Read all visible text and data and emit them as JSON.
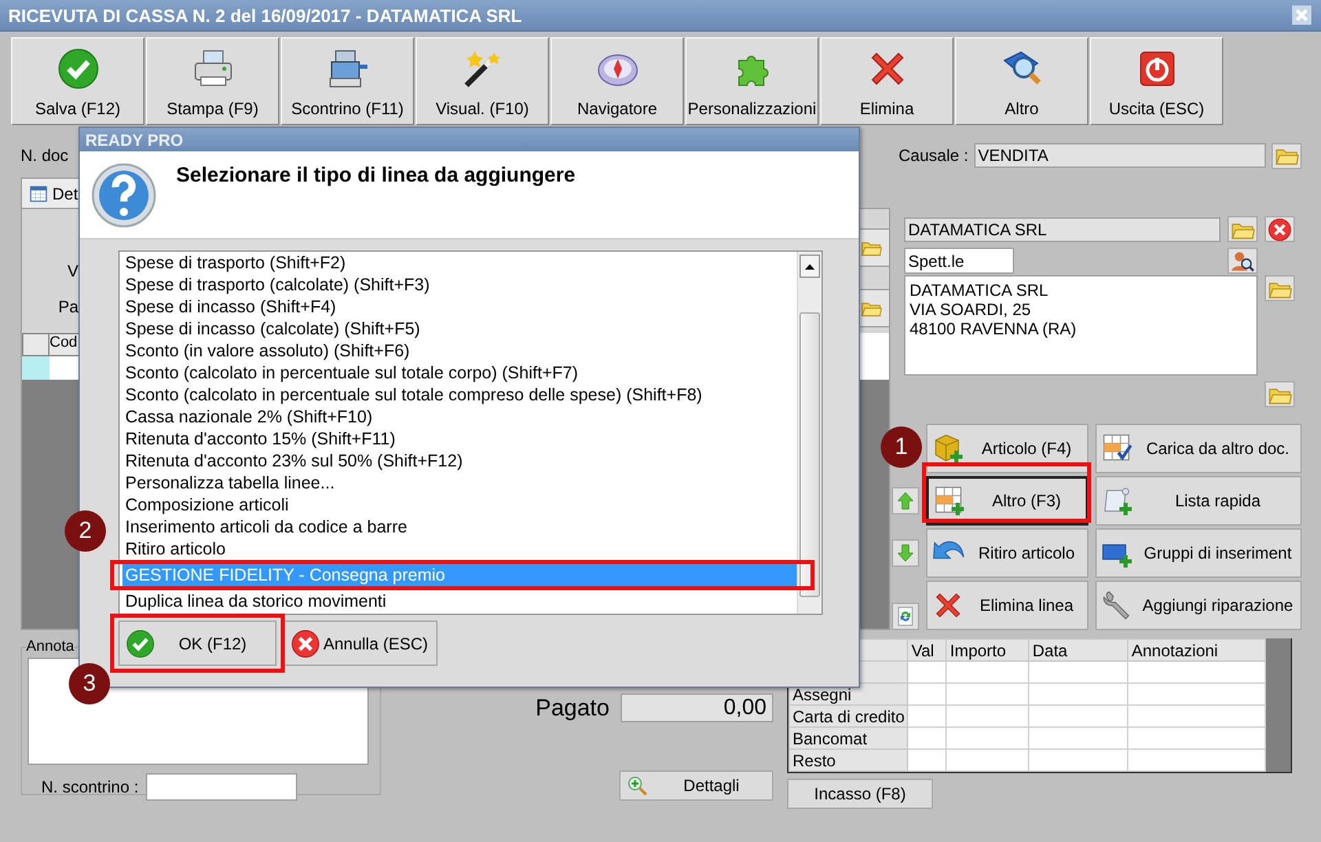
{
  "window": {
    "title": "RICEVUTA DI CASSA N. 2 del 16/09/2017 - DATAMATICA SRL"
  },
  "toolbar": [
    "Salva (F12)",
    "Stampa (F9)",
    "Scontrino (F11)",
    "Visual. (F10)",
    "Navigatore",
    "Personalizzazioni",
    "Elimina",
    "Altro",
    "Uscita (ESC)"
  ],
  "document": {
    "number_label": "N. doc",
    "causale_label": "Causale :",
    "causale": "VENDITA",
    "tab": "Det",
    "labels": [
      "V",
      "Pa"
    ],
    "grid_column": "Cod"
  },
  "customer": {
    "name": "DATAMATICA SRL",
    "salutation": "Spett.le",
    "address": [
      "DATAMATICA SRL",
      "VIA SOARDI, 25",
      "48100 RAVENNA (RA)"
    ]
  },
  "line_buttons": [
    {
      "label": "Articolo (F4)",
      "focused": false
    },
    {
      "label": "Carica da altro doc.",
      "focused": false
    },
    {
      "label": "Altro (F3)",
      "focused": true
    },
    {
      "label": "Lista rapida",
      "focused": false
    },
    {
      "label": "Ritiro articolo",
      "focused": false
    },
    {
      "label": "Gruppi di inseriment",
      "focused": false
    },
    {
      "label": "Elimina linea",
      "focused": false
    },
    {
      "label": "Aggiungi riparazione",
      "focused": false
    }
  ],
  "notes": {
    "label": "Annota",
    "receipt_label": "N. scontrino :"
  },
  "totals": {
    "paid_label": "Pagato",
    "paid": "0,00",
    "details_button": "Dettagli"
  },
  "payments": {
    "columns": [
      "Val",
      "Importo",
      "Data",
      "Annotazioni"
    ],
    "rows": [
      "Assegni",
      "Carta di credito",
      "Bancomat",
      "Resto"
    ],
    "button": "Incasso (F8)"
  },
  "dialog": {
    "title": "READY PRO",
    "heading": "Selezionare il tipo di linea da aggiungere",
    "items": [
      {
        "label": "Spese di trasporto (Shift+F2)",
        "selected": false
      },
      {
        "label": "Spese di trasporto (calcolate) (Shift+F3)",
        "selected": false
      },
      {
        "label": "Spese di incasso (Shift+F4)",
        "selected": false
      },
      {
        "label": "Spese di incasso (calcolate) (Shift+F5)",
        "selected": false
      },
      {
        "label": "Sconto (in valore assoluto) (Shift+F6)",
        "selected": false
      },
      {
        "label": "Sconto (calcolato in percentuale sul totale corpo) (Shift+F7)",
        "selected": false
      },
      {
        "label": "Sconto (calcolato in percentuale sul totale compreso delle spese) (Shift+F8)",
        "selected": false
      },
      {
        "label": "Cassa nazionale 2% (Shift+F10)",
        "selected": false
      },
      {
        "label": "Ritenuta d'acconto 15% (Shift+F11)",
        "selected": false
      },
      {
        "label": "Ritenuta d'acconto 23% sul 50% (Shift+F12)",
        "selected": false
      },
      {
        "label": "Personalizza tabella linee...",
        "selected": false
      },
      {
        "label": "Composizione articoli",
        "selected": false
      },
      {
        "label": "Inserimento articoli da codice a barre",
        "selected": false
      },
      {
        "label": "Ritiro articolo",
        "selected": false
      },
      {
        "label": "GESTIONE FIDELITY - Consegna premio",
        "selected": true
      },
      {
        "label": "Duplica linea da storico movimenti",
        "selected": false
      }
    ],
    "buttons": [
      "OK (F12)",
      "Annulla (ESC)"
    ]
  },
  "callouts": [
    "1",
    "2",
    "3"
  ]
}
